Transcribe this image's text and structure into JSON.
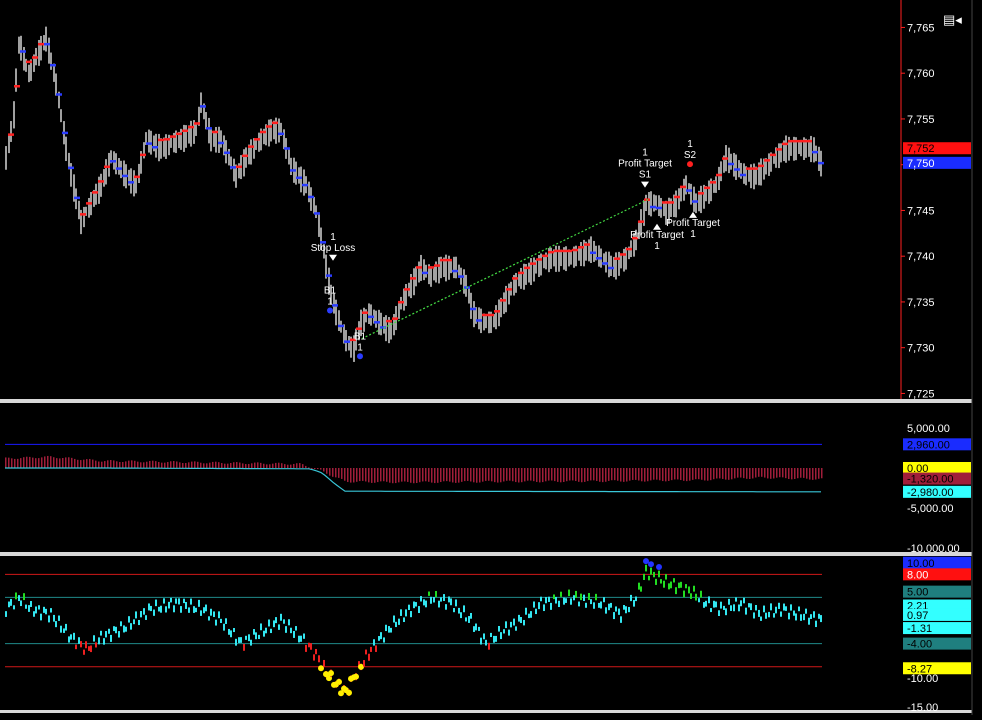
{
  "toolbar": {
    "menu_icon": "menu-icon",
    "glyph": "▤◂"
  },
  "colors": {
    "background": "#000000",
    "bar": "#a0a0a0",
    "up": "#ff2020",
    "down": "#2a3cff",
    "price_axis_line": "#ff2020",
    "separator": "#d8d8d8",
    "trend": "#44dd44",
    "osc_cyan": "#33e6f0",
    "osc_green": "#22dd22",
    "osc_red": "#ee2020",
    "osc_yellow": "#ffee00",
    "osc_blue": "#2233ff",
    "hist": "#a01e3a",
    "line_blue": "#1a1aff",
    "line_cyan": "#39c6d8",
    "band_red": "#d01818",
    "band_teal": "#1f8a8a",
    "tag_red": "#ff1010",
    "tag_blue": "#1a2cff",
    "tag_yellow": "#ffff00",
    "tag_cyan": "#33ffff",
    "tag_teal": "#1f7f7f"
  },
  "price_axis": {
    "ticks": [
      "7,765",
      "7,760",
      "7,755",
      "7,750",
      "7,745",
      "7,740",
      "7,735",
      "7,730",
      "7,725"
    ],
    "tick_values": [
      7765,
      7760,
      7755,
      7750,
      7745,
      7740,
      7735,
      7730,
      7725
    ],
    "ylim": [
      7724.5,
      7768
    ],
    "tags": [
      {
        "label": "7,752",
        "color": "#ff1010",
        "text": "#000000",
        "value": 7751.8
      },
      {
        "label": "7,750",
        "color": "#1a2cff",
        "text": "#ffffff",
        "value": 7750.2
      }
    ]
  },
  "trade_labels": [
    {
      "id": "stop-loss",
      "lines": [
        "1",
        "Stop Loss"
      ],
      "arrow": "down",
      "x": 333,
      "value": 7739.5
    },
    {
      "id": "b1-first",
      "lines": [
        "B1",
        "1"
      ],
      "arrow": "none",
      "x": 330,
      "value": 7734.5
    },
    {
      "id": "b1-second",
      "lines": [
        "B1",
        "1"
      ],
      "arrow": "none",
      "x": 360,
      "value": 7729.5
    },
    {
      "id": "profit-target-top",
      "lines": [
        "1",
        "Profit Target",
        "S1"
      ],
      "arrow": "down",
      "x": 645,
      "value": 7747.5
    },
    {
      "id": "s2",
      "lines": [
        "1",
        "S2"
      ],
      "arrow": "none",
      "x": 690,
      "value": 7750.5
    },
    {
      "id": "profit-target-mid",
      "lines": [
        "Profit Target",
        "1"
      ],
      "arrow": "up",
      "x": 693,
      "value": 7745.5
    },
    {
      "id": "profit-target-low",
      "lines": [
        "Profit Target",
        "1"
      ],
      "arrow": "up",
      "x": 657,
      "value": 7744.2
    }
  ],
  "mid_axis": {
    "ticks": [
      "5,000.00",
      "-5,000.00",
      "-10,000.00"
    ],
    "tick_values": [
      5000,
      -5000,
      -10000
    ],
    "ylim": [
      -10500,
      8000
    ],
    "tags": [
      {
        "label": "2,960.00",
        "color": "#1a2cff",
        "text": "#000000",
        "value": 2960
      },
      {
        "label": "0.00",
        "color": "#ffff00",
        "text": "#000000",
        "value": 0
      },
      {
        "label": "-1,320.00",
        "color": "#a01e3a",
        "text": "#000000",
        "value": -1320
      },
      {
        "label": "-2,980.00",
        "color": "#33ffff",
        "text": "#000000",
        "value": -2980
      }
    ]
  },
  "osc_axis": {
    "ticks": [
      "5.00",
      "-10.00",
      "-15.00"
    ],
    "tick_values": [
      5,
      -10,
      -15
    ],
    "ylim": [
      -15.5,
      11
    ],
    "bands": [
      8,
      4,
      -4,
      -8
    ],
    "tags": [
      {
        "label": "10.00",
        "color": "#1a2cff",
        "text": "#000000",
        "value": 10
      },
      {
        "label": "8.00",
        "color": "#ff1010",
        "text": "#ffffff",
        "value": 8
      },
      {
        "label": "5.00",
        "color": "#1f7f7f",
        "text": "#000000",
        "value": 5
      },
      {
        "label": "2.21",
        "color": "#33ffff",
        "text": "#000000",
        "value": 2.6
      },
      {
        "label": "0.97",
        "color": "#33ffff",
        "text": "#000000",
        "value": 0.97
      },
      {
        "label": "-1.31",
        "color": "#33ffff",
        "text": "#000000",
        "value": -1.31
      },
      {
        "label": "-4.00",
        "color": "#1f7f7f",
        "text": "#000000",
        "value": -4
      },
      {
        "label": "-8.27",
        "color": "#ffff00",
        "text": "#000000",
        "value": -8.27
      }
    ]
  }
}
